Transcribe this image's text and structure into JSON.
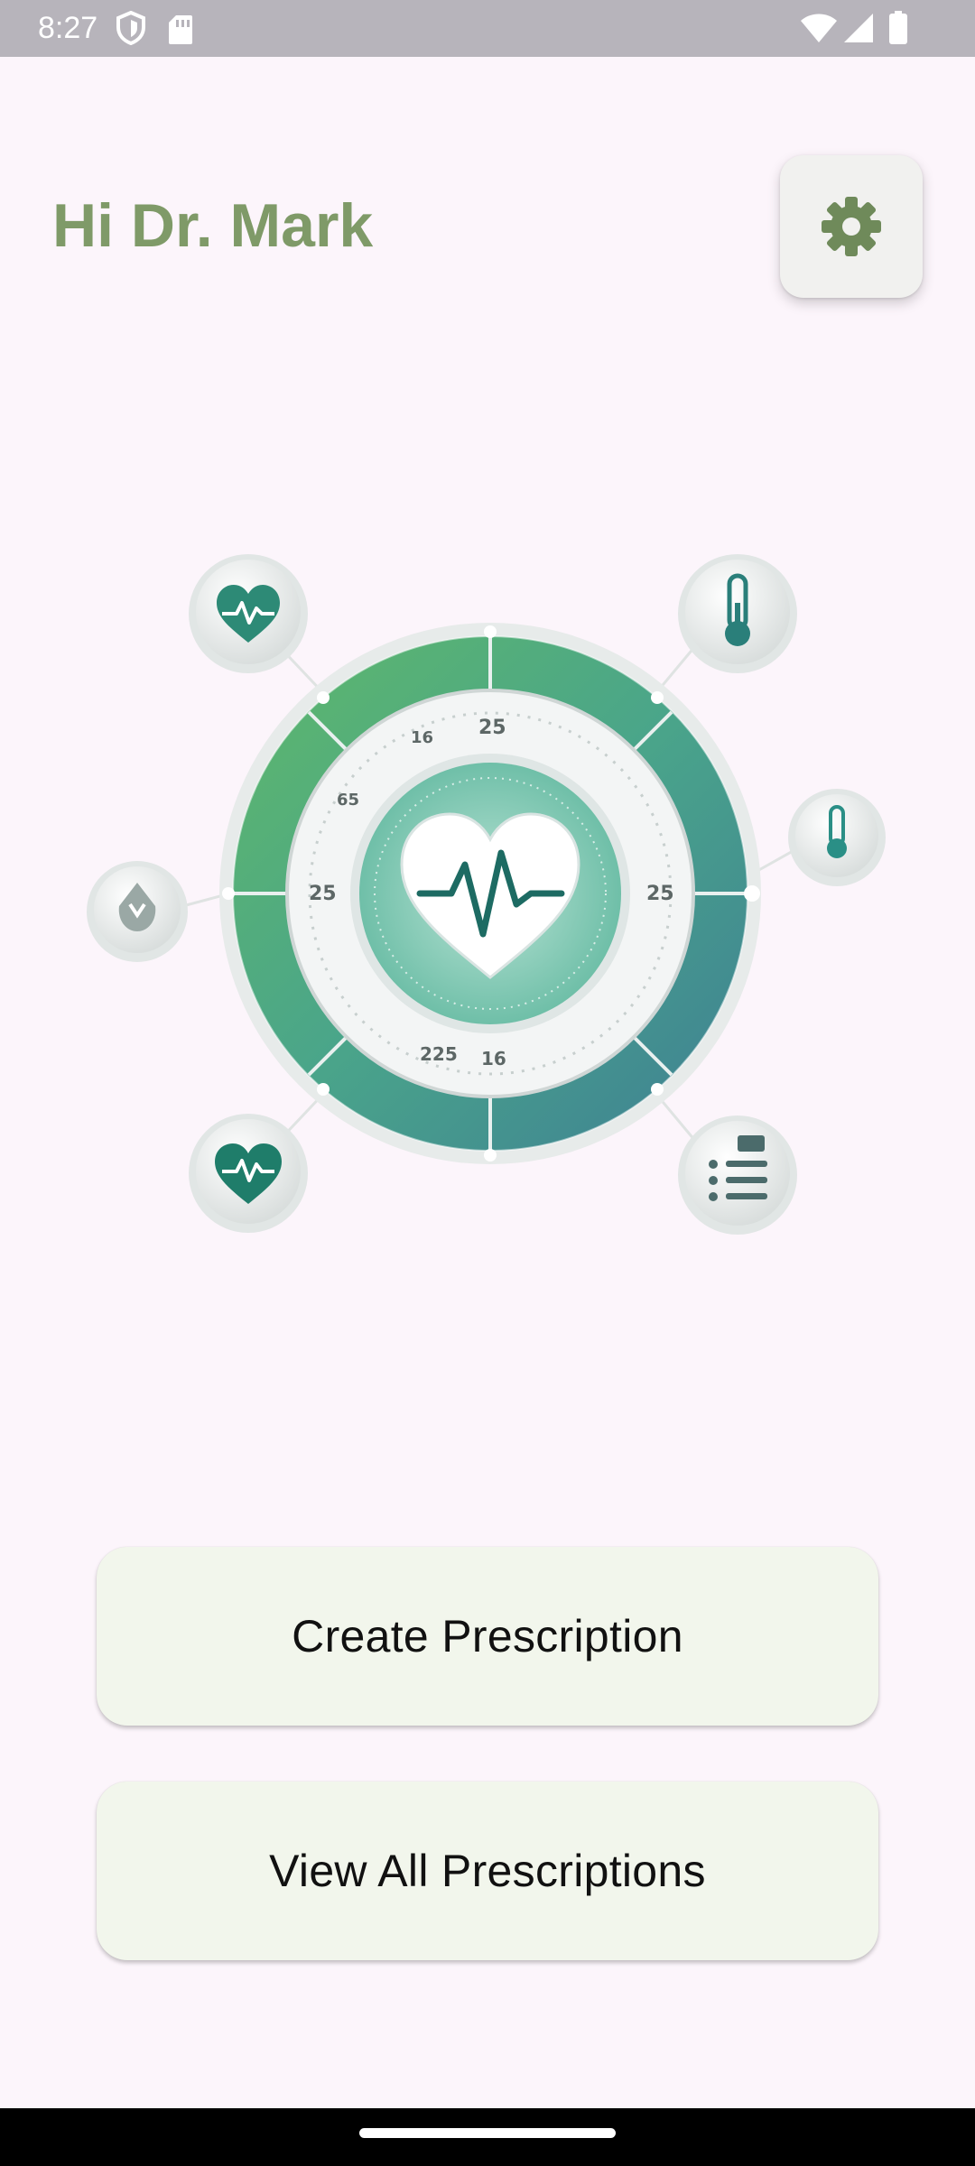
{
  "status_bar": {
    "time": "8:27",
    "icons_left": [
      "shield-icon",
      "sim-card-icon"
    ],
    "icons_right": [
      "wifi-icon",
      "signal-icon",
      "battery-icon"
    ],
    "background": "#b7b4bb"
  },
  "header": {
    "greeting": "Hi Dr. Mark",
    "greeting_color": "#7f9a68",
    "settings_icon": "gear-icon"
  },
  "hero": {
    "image": "health-monitoring-dial-illustration",
    "dial_ticks": [
      "25",
      "16",
      "65",
      "25",
      "25",
      "225",
      "16"
    ],
    "satellite_icons": [
      "heart-pulse-icon",
      "thermometer-icon",
      "thermometer-small-icon",
      "drop-icon",
      "heart-pulse-icon",
      "checklist-icon"
    ]
  },
  "actions": {
    "create_label": "Create Prescription",
    "view_label": "View All Prescriptions",
    "button_bg": "#f2f6ec"
  }
}
